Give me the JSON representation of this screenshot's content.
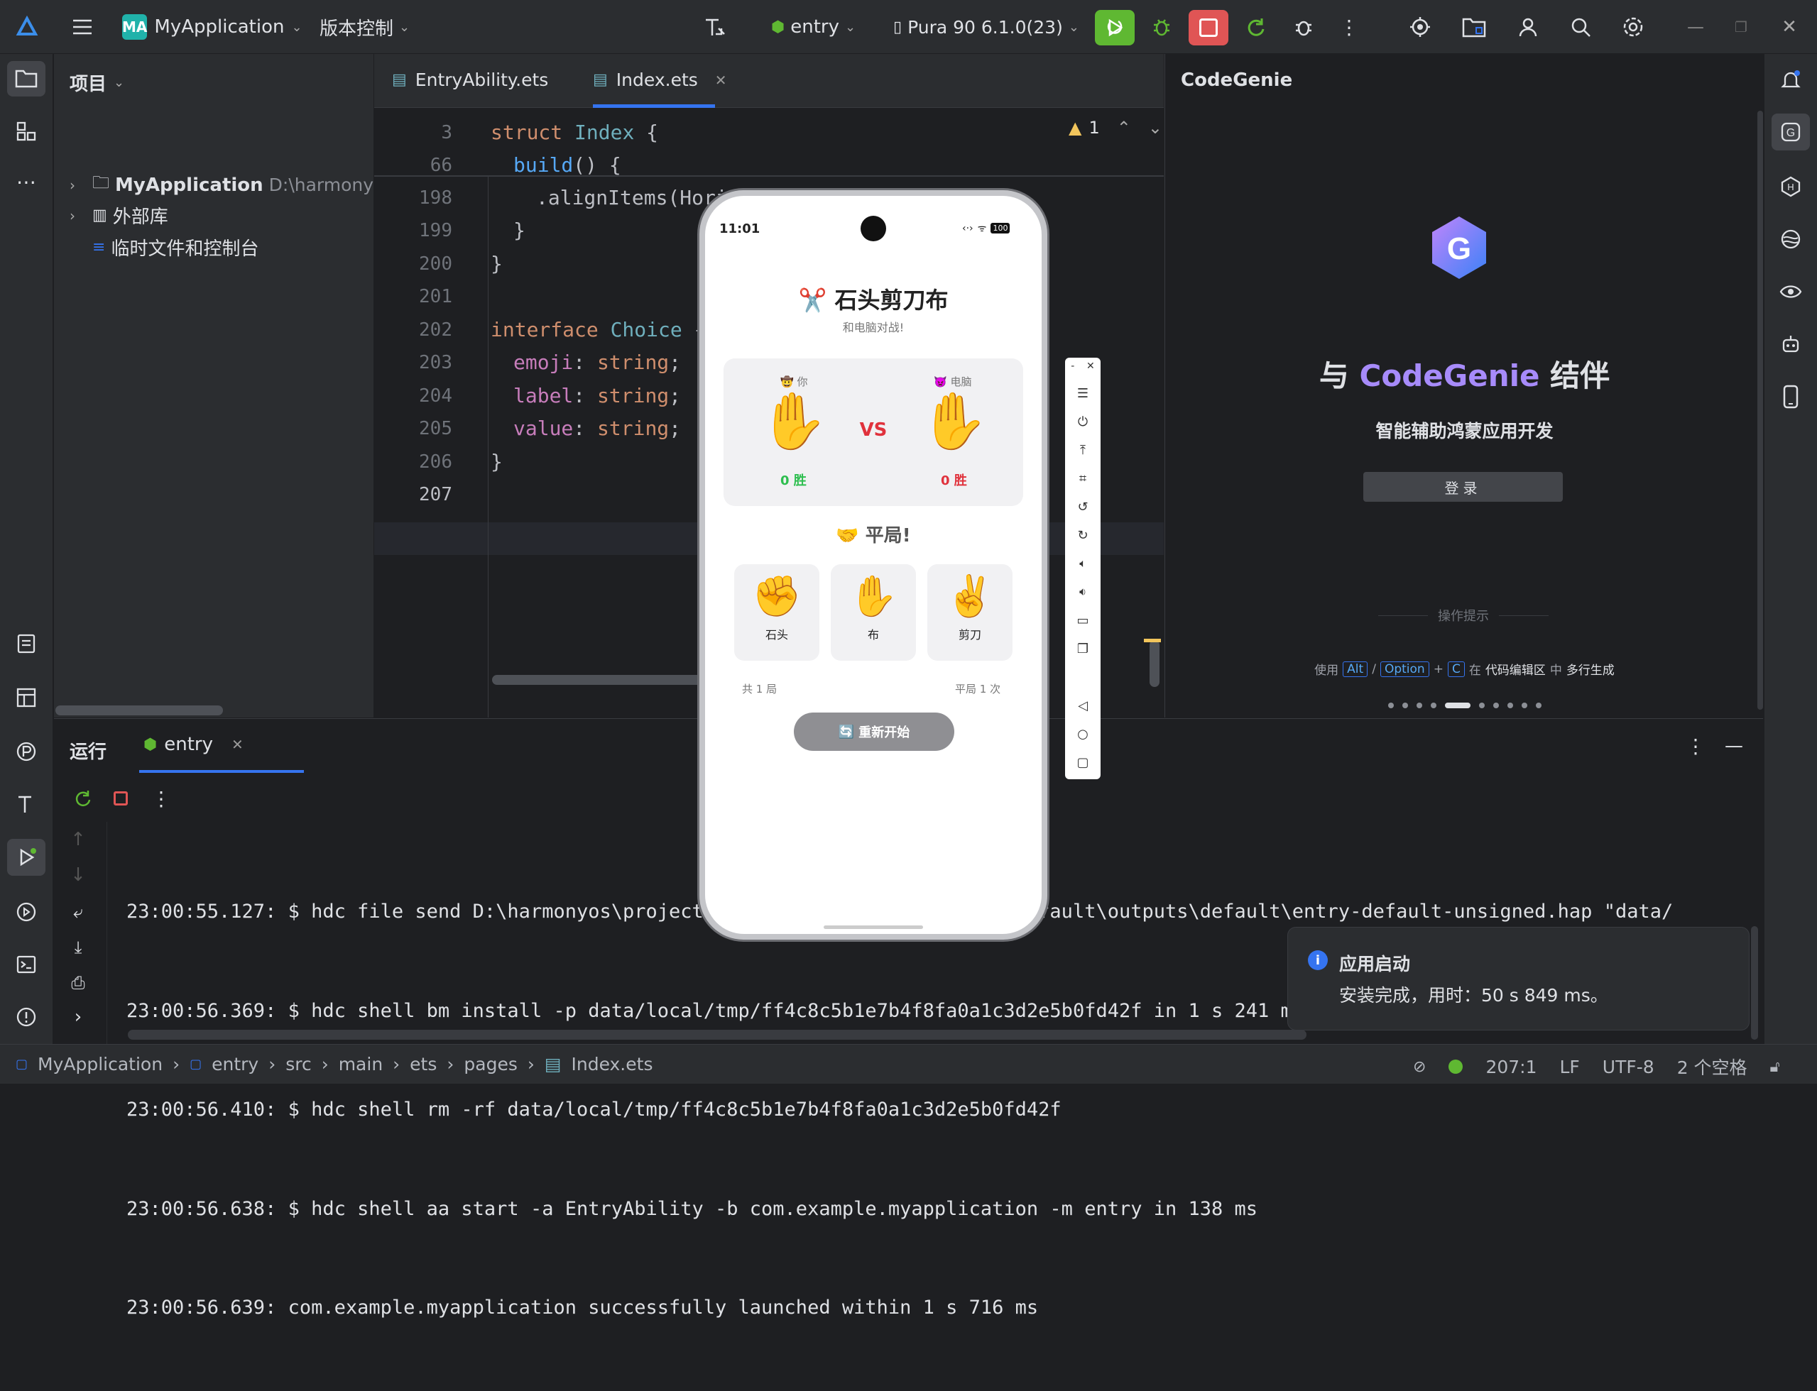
{
  "topbar": {
    "project_badge": "MA",
    "project_name": "MyApplication",
    "vcs_label": "版本控制",
    "run_config": "entry",
    "device": "Pura 90 6.1.0(23)"
  },
  "project_panel": {
    "title": "项目",
    "items": [
      {
        "label": "MyApplication",
        "path": "D:\\harmonyos\\"
      },
      {
        "label": "外部库"
      },
      {
        "label": "临时文件和控制台"
      }
    ]
  },
  "editor": {
    "tabs": [
      {
        "label": "EntryAbility.ets"
      },
      {
        "label": "Index.ets"
      }
    ],
    "warning_count": "1",
    "lines": [
      {
        "num": "3",
        "text": "struct Index {"
      },
      {
        "num": "66",
        "text": "build() {"
      },
      {
        "num": "198",
        "text": ".alignItems(HorizontalAlign.Center)"
      },
      {
        "num": "199",
        "text": "}"
      },
      {
        "num": "200",
        "text": "}"
      },
      {
        "num": "201",
        "text": ""
      },
      {
        "num": "202",
        "text": "interface Choice {"
      },
      {
        "num": "203",
        "text": "emoji: string;"
      },
      {
        "num": "204",
        "text": "label: string;"
      },
      {
        "num": "205",
        "text": "value: string;"
      },
      {
        "num": "206",
        "text": "}"
      },
      {
        "num": "207",
        "text": ""
      }
    ]
  },
  "codegenie": {
    "title": "CodeGenie",
    "heading_prefix": "与",
    "heading_brand": "CodeGenie",
    "heading_suffix": "结伴",
    "subtitle": "智能辅助鸿蒙应用开发",
    "login_button": "登录",
    "tips_label": "操作提示",
    "hint_use": "使用",
    "hint_alt": "Alt",
    "hint_slash": "/",
    "hint_option": "Option",
    "hint_plus": "+",
    "hint_c": "C",
    "hint_in": "在",
    "hint_area": "代码编辑区",
    "hint_mid": "中",
    "hint_action": "多行生成",
    "carousel_active_index": 4,
    "carousel_count": 10
  },
  "run_panel": {
    "title": "运行",
    "tab_label": "entry",
    "log_lines": [
      "23:00:55.127: $ hdc file send D:\\harmonyos\\project\\MyApplication\\entry\\build\\default\\outputs\\default\\entry-default-unsigned.hap \"data/",
      "23:00:56.369: $ hdc shell bm install -p data/local/tmp/ff4c8c5b1e7b4f8fa0a1c3d2e5b0fd42f in 1 s 241 ms",
      "23:00:56.410: $ hdc shell rm -rf data/local/tmp/ff4c8c5b1e7b4f8fa0a1c3d2e5b0fd42f",
      "23:00:56.638: $ hdc shell aa start -a EntryAbility -b com.example.myapplication -m entry in 138 ms",
      "23:00:56.639: com.example.myapplication successfully launched within 1 s 716 ms"
    ]
  },
  "toast": {
    "title": "应用启动",
    "message": "安装完成，用时：50 s 849 ms。"
  },
  "status_bar": {
    "breadcrumb": [
      "MyApplication",
      "entry",
      "src",
      "main",
      "ets",
      "pages",
      "Index.ets"
    ],
    "position": "207:1",
    "line_ending": "LF",
    "encoding": "UTF-8",
    "indent": "2 个空格"
  },
  "phone": {
    "time": "11:01",
    "battery": "100",
    "title_emoji": "✂️",
    "title": "石头剪刀布",
    "subtitle": "和电脑对战!",
    "player_label": "你",
    "player_label_emoji": "🤠",
    "computer_label": "电脑",
    "computer_label_emoji": "👿",
    "player_choice": "✋",
    "computer_choice": "✋",
    "vs": "VS",
    "player_score": "0 胜",
    "computer_score": "0 胜",
    "result_emoji": "🤝",
    "result": "平局!",
    "choices": [
      {
        "emoji": "✊",
        "label": "石头"
      },
      {
        "emoji": "✋",
        "label": "布"
      },
      {
        "emoji": "✌️",
        "label": "剪刀"
      }
    ],
    "total_rounds": "共 1 局",
    "draws": "平局 1 次",
    "restart_icon": "🔄",
    "restart_label": "重新开始"
  },
  "colors": {
    "accent_blue": "#3574f0",
    "run_green": "#5fb832",
    "stop_red": "#e05555",
    "win_green": "#2dbe4e",
    "lose_red": "#e0323c",
    "brand_purple": "#a78bfa"
  }
}
